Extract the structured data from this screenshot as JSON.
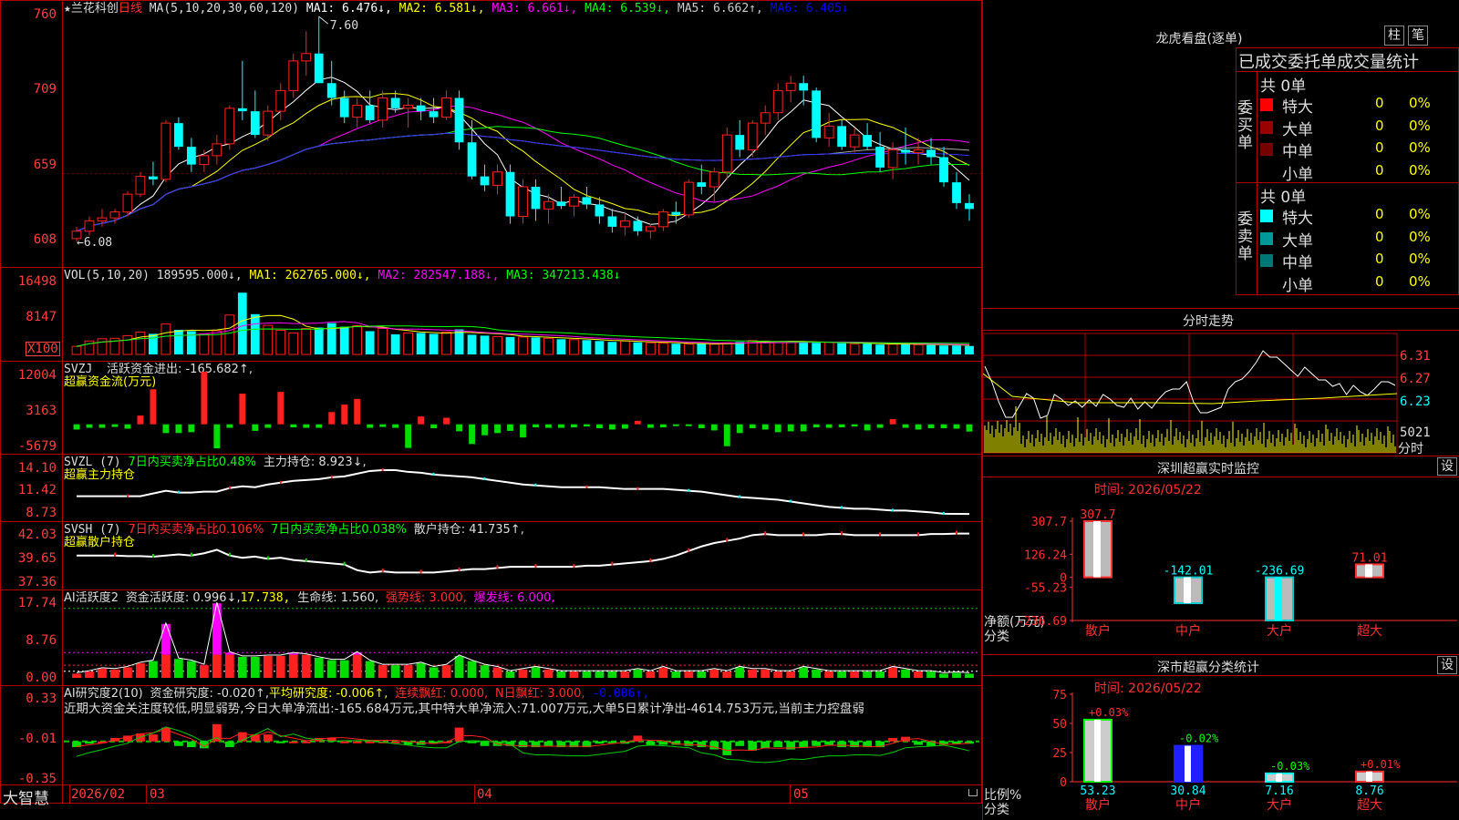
{
  "main": {
    "title_star": "★",
    "stock_name": "兰花科创",
    "period": "日线",
    "ma_spec": "MA(5,10,20,30,60,120)",
    "ma_values": [
      {
        "text": "MA1: 6.476↓,",
        "color": "#ffffff"
      },
      {
        "text": "MA2: 6.581↓,",
        "color": "#ffff00"
      },
      {
        "text": "MA3: 6.661↓,",
        "color": "#ff00ff"
      },
      {
        "text": "MA4: 6.539↓,",
        "color": "#00ff00"
      },
      {
        "text": "MA5: 6.662↑,",
        "color": "#cccccc"
      },
      {
        "text": "MA6: 6.405↓",
        "color": "#0000ff"
      }
    ],
    "y_ticks": [
      "760",
      "709",
      "659",
      "608"
    ],
    "high_label": "7.60",
    "low_label": "6.08"
  },
  "vol": {
    "spec": "VOL(5,10,20)",
    "value": "189595.000↓,",
    "ma1": "MA1: 262765.000↓,",
    "ma2": "MA2: 282547.188↓,",
    "ma3": "MA3: 347213.438↓",
    "y_ticks": [
      "16498",
      "8147"
    ],
    "unit": "X100"
  },
  "svzj": {
    "name": "SVZJ",
    "label": "活跃资金进出: -165.682↑,",
    "subtitle": "超赢资金流(万元)",
    "y_ticks": [
      "12004",
      "3163",
      "-5679"
    ]
  },
  "svzl": {
    "name": "SVZL (7)",
    "label1": "7日内买卖净占比0.48%",
    "label2": "主力持仓: 8.923↓,",
    "subtitle": "超赢主力持仓",
    "y_ticks": [
      "14.10",
      "11.42",
      "8.73"
    ]
  },
  "svsh": {
    "name": "SVSH (7)",
    "label1": "7日内买卖净占比0.106%",
    "label2": "7日内买卖净占比0.038%",
    "label3": "散户持仓: 41.735↑,",
    "subtitle": "超赢散户持仓",
    "y_ticks": [
      "42.03",
      "39.65",
      "37.36"
    ]
  },
  "ai1": {
    "name": "AI活跃度2",
    "label1": "资金活跃度: 0.996↓,",
    "label2": "17.738,",
    "label3": "生命线: 1.560,",
    "label4": "强势线: 3.000,",
    "label5": "爆发线: 6.000,",
    "y_ticks": [
      "17.74",
      "8.76",
      "0.00"
    ]
  },
  "ai2": {
    "name": "AI研究度2(10)",
    "label1": "资金研究度: -0.020↑,",
    "label2": "平均研究度: -0.006↑,",
    "label3": "连续飘红: 0.000,",
    "label4": "N日飘红: 3.000,",
    "label5": "-0.006↑,",
    "commentary": "近期大资金关注度较低,明显弱势,今日大单净流出:-165.684万元,其中特大单净流入:71.007万元,大单5日累计净出-4614.753万元,当前主力控盘弱",
    "y_ticks": [
      "0.33",
      "-0.01",
      "-0.35"
    ]
  },
  "bottom": {
    "brand": "大智慧",
    "dates": [
      "2026/02",
      "03",
      "04",
      "05"
    ]
  },
  "dragon": {
    "title": "龙虎看盘(逐单)",
    "btn1": "柱",
    "btn2": "笔",
    "header": "已成交委托单成交量统计",
    "buy_total": "共 0单",
    "sell_total": "共 0单",
    "buy_side": "委买单",
    "sell_side": "委卖单",
    "buy_rows": [
      {
        "name": "特大",
        "count": "0",
        "pct": "0%",
        "color": "#ff0000"
      },
      {
        "name": "大单",
        "count": "0",
        "pct": "0%",
        "color": "#990000"
      },
      {
        "name": "中单",
        "count": "0",
        "pct": "0%",
        "color": "#770000"
      },
      {
        "name": "小单",
        "count": "0",
        "pct": "0%",
        "color": ""
      }
    ],
    "sell_rows": [
      {
        "name": "特大",
        "count": "0",
        "pct": "0%",
        "color": "#00ffff"
      },
      {
        "name": "大单",
        "count": "0",
        "pct": "0%",
        "color": "#009999"
      },
      {
        "name": "中单",
        "count": "0",
        "pct": "0%",
        "color": "#007777"
      },
      {
        "name": "小单",
        "count": "0",
        "pct": "0%",
        "color": ""
      }
    ]
  },
  "intraday": {
    "title": "分时走势",
    "prices": [
      "6.31",
      "6.27",
      "6.23"
    ],
    "vol_max": "5021",
    "vol_unit": "分时"
  },
  "monitor": {
    "title": "深圳超赢实时监控",
    "settings": "设",
    "time": "时间: 2026/05/22",
    "y_ticks": [
      "307.7",
      "126.24",
      "0",
      "-55.23",
      "-236.69"
    ],
    "ylabel1": "净额(万元)",
    "ylabel2": "分类",
    "categories": [
      "散户",
      "中户",
      "大户",
      "超大"
    ],
    "values": [
      307.7,
      -142.01,
      -236.69,
      71.01
    ],
    "value_labels": [
      "307.7",
      "-142.01",
      "-236.69",
      "71.01"
    ]
  },
  "classify": {
    "title": "深市超赢分类统计",
    "settings": "设",
    "time": "时间: 2026/05/22",
    "y_ticks": [
      "75",
      "50",
      "25",
      "0"
    ],
    "ylabel1": "比例%",
    "ylabel2": "分类",
    "categories": [
      "散户",
      "中户",
      "大户",
      "超大"
    ],
    "values": [
      53.23,
      30.84,
      7.16,
      8.76
    ],
    "value_labels": [
      "53.23",
      "30.84",
      "7.16",
      "8.76"
    ],
    "change_labels": [
      "+0.03%",
      "-0.02%",
      "-0.03%",
      "+0.01%"
    ]
  },
  "chart_data": [
    {
      "type": "candlestick",
      "title": "兰花科创 日线",
      "ylim": [
        6.05,
        7.65
      ],
      "annotations": {
        "high": 7.6,
        "low": 6.08
      },
      "ohlc": [
        [
          6.1,
          6.18,
          6.08,
          6.15
        ],
        [
          6.15,
          6.25,
          6.12,
          6.22
        ],
        [
          6.22,
          6.3,
          6.18,
          6.24
        ],
        [
          6.24,
          6.3,
          6.2,
          6.28
        ],
        [
          6.28,
          6.42,
          6.25,
          6.4
        ],
        [
          6.4,
          6.55,
          6.38,
          6.52
        ],
        [
          6.52,
          6.62,
          6.46,
          6.5
        ],
        [
          6.5,
          6.9,
          6.48,
          6.88
        ],
        [
          6.88,
          6.92,
          6.7,
          6.72
        ],
        [
          6.72,
          6.78,
          6.55,
          6.6
        ],
        [
          6.6,
          6.7,
          6.55,
          6.66
        ],
        [
          6.66,
          6.8,
          6.6,
          6.74
        ],
        [
          6.74,
          7.0,
          6.7,
          6.98
        ],
        [
          6.98,
          7.3,
          6.9,
          6.96
        ],
        [
          6.96,
          7.1,
          6.78,
          6.8
        ],
        [
          6.8,
          7.0,
          6.76,
          6.96
        ],
        [
          6.96,
          7.15,
          6.9,
          7.1
        ],
        [
          7.1,
          7.35,
          7.05,
          7.3
        ],
        [
          7.3,
          7.5,
          7.2,
          7.35
        ],
        [
          7.35,
          7.6,
          7.25,
          7.15
        ],
        [
          7.15,
          7.3,
          7.0,
          7.05
        ],
        [
          7.05,
          7.1,
          6.88,
          6.92
        ],
        [
          6.92,
          7.05,
          6.85,
          7.0
        ],
        [
          7.0,
          7.1,
          6.88,
          6.9
        ],
        [
          6.9,
          7.1,
          6.85,
          7.05
        ],
        [
          7.05,
          7.1,
          6.95,
          6.98
        ],
        [
          6.98,
          7.05,
          6.85,
          7.0
        ],
        [
          7.0,
          7.05,
          6.9,
          6.96
        ],
        [
          6.96,
          7.05,
          6.88,
          6.92
        ],
        [
          6.92,
          7.1,
          6.9,
          7.05
        ],
        [
          7.05,
          7.1,
          6.7,
          6.75
        ],
        [
          6.75,
          6.9,
          6.5,
          6.52
        ],
        [
          6.52,
          6.6,
          6.42,
          6.46
        ],
        [
          6.46,
          6.6,
          6.4,
          6.55
        ],
        [
          6.55,
          6.6,
          6.2,
          6.25
        ],
        [
          6.25,
          6.5,
          6.2,
          6.45
        ],
        [
          6.45,
          6.5,
          6.22,
          6.3
        ],
        [
          6.3,
          6.4,
          6.2,
          6.35
        ],
        [
          6.35,
          6.45,
          6.3,
          6.32
        ],
        [
          6.32,
          6.4,
          6.25,
          6.38
        ],
        [
          6.38,
          6.45,
          6.3,
          6.33
        ],
        [
          6.33,
          6.38,
          6.2,
          6.25
        ],
        [
          6.25,
          6.3,
          6.14,
          6.18
        ],
        [
          6.18,
          6.28,
          6.12,
          6.22
        ],
        [
          6.22,
          6.25,
          6.12,
          6.15
        ],
        [
          6.15,
          6.2,
          6.1,
          6.18
        ],
        [
          6.18,
          6.3,
          6.15,
          6.28
        ],
        [
          6.28,
          6.35,
          6.2,
          6.26
        ],
        [
          6.26,
          6.5,
          6.24,
          6.48
        ],
        [
          6.48,
          6.6,
          6.4,
          6.45
        ],
        [
          6.45,
          6.58,
          6.35,
          6.55
        ],
        [
          6.55,
          6.85,
          6.5,
          6.8
        ],
        [
          6.8,
          6.9,
          6.65,
          6.7
        ],
        [
          6.7,
          6.9,
          6.65,
          6.88
        ],
        [
          6.88,
          7.0,
          6.8,
          6.95
        ],
        [
          6.95,
          7.15,
          6.9,
          7.1
        ],
        [
          7.1,
          7.2,
          7.02,
          7.15
        ],
        [
          7.15,
          7.2,
          7.0,
          7.1
        ],
        [
          7.1,
          7.12,
          6.75,
          6.78
        ],
        [
          6.78,
          6.95,
          6.72,
          6.86
        ],
        [
          6.86,
          6.9,
          6.7,
          6.72
        ],
        [
          6.72,
          6.85,
          6.68,
          6.8
        ],
        [
          6.8,
          6.88,
          6.7,
          6.72
        ],
        [
          6.72,
          6.82,
          6.55,
          6.58
        ],
        [
          6.58,
          6.75,
          6.5,
          6.7
        ],
        [
          6.7,
          6.85,
          6.6,
          6.68
        ],
        [
          6.68,
          6.78,
          6.6,
          6.7
        ],
        [
          6.7,
          6.78,
          6.6,
          6.65
        ],
        [
          6.65,
          6.72,
          6.45,
          6.48
        ],
        [
          6.48,
          6.55,
          6.3,
          6.34
        ],
        [
          6.34,
          6.4,
          6.22,
          6.3
        ]
      ]
    },
    {
      "type": "bar",
      "title": "VOL(5,10,20)",
      "ylim": [
        0,
        16498
      ],
      "values": [
        1800,
        3000,
        3500,
        3600,
        4200,
        5000,
        4600,
        6800,
        5500,
        5200,
        4600,
        5300,
        8800,
        13800,
        9000,
        6500,
        5400,
        4800,
        5800,
        6000,
        7000,
        6200,
        6400,
        5200,
        5800,
        4500,
        4800,
        4800,
        4600,
        5000,
        5600,
        4400,
        4200,
        4000,
        3900,
        3900,
        3800,
        3600,
        3400,
        3300,
        3200,
        3000,
        2800,
        3000,
        2700,
        2600,
        2500,
        2400,
        2300,
        2400,
        2300,
        2600,
        2800,
        3100,
        3000,
        2900,
        2800,
        2700,
        2600,
        2700,
        2500,
        2300,
        2400,
        2200,
        2300,
        2400,
        2200,
        2100,
        2000,
        2000,
        1896
      ],
      "ma_values": {
        "MA1": 262765.0,
        "MA2": 282547.188,
        "MA3": 347213.438
      }
    },
    {
      "type": "bar",
      "title": "SVZJ 活跃资金进出",
      "ylim": [
        -5679,
        12004
      ],
      "values": [
        -1200,
        -800,
        -800,
        -600,
        -1000,
        2000,
        8000,
        -2000,
        -2000,
        -1800,
        12000,
        -5500,
        -800,
        7000,
        -1500,
        -800,
        7400,
        -700,
        -800,
        -800,
        2800,
        4500,
        5800,
        -800,
        -600,
        -800,
        -5400,
        1800,
        -900,
        1500,
        -1600,
        -4500,
        -2500,
        -2000,
        -1500,
        -3000,
        -700,
        -800,
        -800,
        -700,
        -500,
        -900,
        -1200,
        -1000,
        800,
        -800,
        -700,
        -300,
        -300,
        -900,
        -1400,
        -5000,
        -2000,
        -900,
        -1200,
        -1800,
        -1600,
        -1600,
        -700,
        -800,
        -700,
        -500,
        -1400,
        -800,
        1200,
        -800,
        -1200,
        -900,
        -900,
        -1000,
        -1656
      ]
    },
    {
      "type": "line",
      "title": "SVZL 主力持仓",
      "ylim": [
        8.73,
        14.1
      ],
      "values": [
        10.9,
        10.9,
        10.9,
        10.9,
        10.9,
        10.9,
        11.2,
        11.5,
        11.3,
        11.3,
        11.4,
        11.4,
        11.8,
        12.0,
        11.9,
        12.2,
        12.4,
        12.6,
        12.7,
        12.8,
        13.0,
        13.1,
        13.4,
        13.7,
        13.8,
        13.8,
        13.6,
        13.5,
        13.3,
        13.2,
        13.1,
        13.0,
        12.8,
        12.6,
        12.4,
        12.2,
        12.1,
        12.0,
        11.9,
        11.9,
        11.9,
        11.9,
        11.8,
        11.7,
        11.7,
        11.7,
        11.7,
        11.6,
        11.5,
        11.4,
        11.2,
        11.0,
        10.8,
        10.7,
        10.6,
        10.5,
        10.3,
        10.1,
        9.9,
        9.7,
        9.6,
        9.5,
        9.5,
        9.4,
        9.3,
        9.3,
        9.2,
        9.1,
        8.95,
        8.93,
        8.923
      ]
    },
    {
      "type": "line",
      "title": "SVSH 散户持仓",
      "ylim": [
        37.36,
        42.03
      ],
      "values": [
        39.8,
        39.8,
        39.8,
        39.8,
        39.75,
        39.75,
        39.7,
        39.8,
        39.9,
        39.8,
        40.0,
        40.3,
        39.8,
        39.6,
        39.7,
        39.5,
        39.6,
        39.4,
        39.3,
        39.2,
        39.1,
        39.0,
        38.5,
        38.3,
        38.4,
        38.3,
        38.3,
        38.3,
        38.3,
        38.4,
        38.5,
        38.6,
        38.6,
        38.7,
        38.8,
        38.8,
        38.8,
        38.8,
        38.8,
        38.8,
        38.9,
        38.9,
        39.0,
        39.1,
        39.2,
        39.3,
        39.5,
        39.8,
        40.2,
        40.6,
        40.9,
        41.1,
        41.3,
        41.6,
        41.7,
        41.6,
        41.6,
        41.6,
        41.6,
        41.7,
        41.7,
        41.6,
        41.6,
        41.6,
        41.6,
        41.6,
        41.6,
        41.7,
        41.7,
        41.74,
        41.735
      ]
    },
    {
      "type": "bar",
      "title": "AI活跃度2 资金活跃度",
      "ylim": [
        0,
        17.74
      ],
      "values": [
        1.0,
        1.5,
        2.2,
        2.0,
        2.5,
        3.5,
        4.0,
        12.8,
        4.5,
        4.0,
        3.0,
        17.7,
        6.0,
        5.0,
        5.0,
        5.2,
        5.2,
        5.8,
        5.5,
        4.8,
        4.2,
        4.2,
        6.0,
        4.0,
        3.0,
        3.0,
        3.0,
        3.5,
        2.5,
        3.0,
        5.2,
        4.0,
        3.0,
        2.5,
        1.5,
        2.0,
        2.5,
        2.0,
        1.5,
        1.5,
        1.5,
        1.5,
        1.5,
        1.5,
        2.0,
        1.5,
        2.5,
        1.5,
        1.5,
        1.5,
        2.0,
        1.5,
        2.5,
        2.0,
        2.0,
        1.5,
        1.5,
        2.5,
        2.0,
        1.5,
        1.5,
        1.5,
        1.5,
        1.5,
        2.5,
        2.0,
        1.5,
        1.5,
        1.0,
        1.2,
        0.996
      ],
      "reference_lines": {
        "life": 1.56,
        "strong": 3.0,
        "burst": 6.0
      }
    },
    {
      "type": "bar",
      "title": "AI研究度2(10)",
      "ylim": [
        -0.35,
        0.33
      ],
      "values": [
        -0.05,
        -0.02,
        0.0,
        0.03,
        0.05,
        0.07,
        0.06,
        0.12,
        -0.04,
        -0.05,
        -0.06,
        0.15,
        -0.05,
        0.08,
        0.06,
        0.06,
        -0.01,
        0.0,
        0.0,
        0.03,
        0.03,
        0.0,
        0.0,
        0.0,
        0.0,
        0.0,
        -0.03,
        -0.03,
        -0.02,
        0.0,
        0.12,
        -0.01,
        -0.04,
        -0.04,
        -0.04,
        -0.05,
        -0.05,
        -0.04,
        -0.05,
        -0.05,
        -0.05,
        -0.02,
        -0.01,
        -0.02,
        0.05,
        -0.03,
        -0.03,
        -0.03,
        -0.04,
        -0.05,
        -0.07,
        -0.12,
        -0.04,
        -0.08,
        -0.06,
        -0.05,
        -0.07,
        -0.05,
        -0.04,
        -0.03,
        -0.05,
        -0.05,
        -0.05,
        -0.05,
        0.03,
        0.04,
        -0.03,
        -0.04,
        -0.03,
        -0.02,
        -0.02
      ]
    }
  ]
}
